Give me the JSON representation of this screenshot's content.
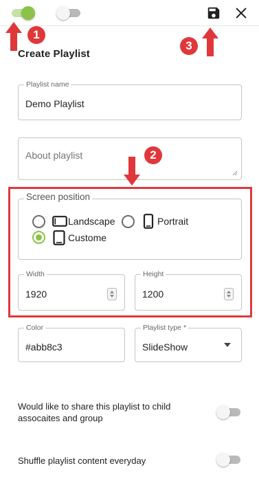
{
  "toolbar": {
    "toggle_on_color": "#8bc34a",
    "save_icon": "save-icon",
    "close_icon": "close-icon"
  },
  "annotations": {
    "badge_1": "1",
    "badge_2": "2",
    "badge_3": "3",
    "color": "#e0373a"
  },
  "form": {
    "title": "Create Playlist",
    "playlist_name": {
      "label": "Playlist name",
      "value": "Demo Playlist"
    },
    "about": {
      "placeholder": "About playlist"
    },
    "screen_position": {
      "label": "Screen position",
      "options": [
        {
          "label": "Landscape",
          "icon": "landscape-screen-icon",
          "checked": false
        },
        {
          "label": "Portrait",
          "icon": "portrait-screen-icon",
          "checked": false
        },
        {
          "label": "Custome",
          "icon": "custom-screen-icon",
          "checked": true
        }
      ]
    },
    "width": {
      "label": "Width",
      "value": "1920"
    },
    "height": {
      "label": "Height",
      "value": "1200"
    },
    "color": {
      "label": "Color",
      "value": "#abb8c3"
    },
    "playlist_type": {
      "label": "Playlist type *",
      "value": "SlideShow"
    },
    "share_option": {
      "label": "Would like to share this playlist to child assocaites and group",
      "enabled": false
    },
    "shuffle_option": {
      "label": "Shuffle playlist content everyday",
      "enabled": false
    }
  }
}
